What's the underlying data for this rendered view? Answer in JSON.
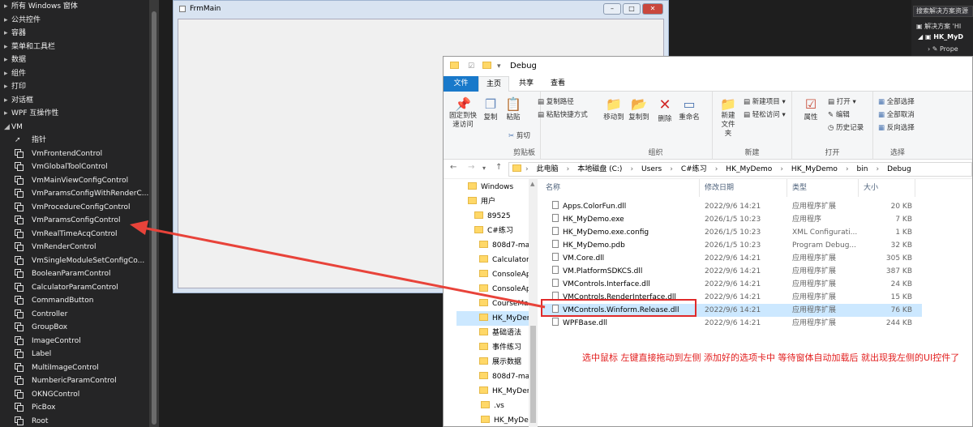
{
  "toolbox": {
    "categories": [
      "所有 Windows 窗体",
      "公共控件",
      "容器",
      "菜单和工具栏",
      "数据",
      "组件",
      "打印",
      "对话框",
      "WPF 互操作性"
    ],
    "vm_category": "VM",
    "pointer": "指针",
    "controls": [
      "VmFrontendControl",
      "VmGlobalToolControl",
      "VmMainViewConfigControl",
      "VmParamsConfigWithRenderC...",
      "VmProcedureConfigControl",
      "VmParamsConfigControl",
      "VmRealTimeAcqControl",
      "VmRenderControl",
      "VmSingleModuleSetConfigCo...",
      "BooleanParamControl",
      "CalculatorParamControl",
      "CommandButton",
      "Controller",
      "GroupBox",
      "ImageControl",
      "Label",
      "MultiImageControl",
      "NumbericParamControl",
      "OKNGControl",
      "PicBox",
      "Root"
    ]
  },
  "form": {
    "title": "FrmMain",
    "min": "0",
    "max": "1",
    "close": "r"
  },
  "solution": {
    "search": "搜索解决方案资源",
    "row1": "解决方案 'HI",
    "row2": "HK_MyD",
    "row3": "Prope"
  },
  "explorer": {
    "title": "Debug",
    "tabs": [
      "文件",
      "主页",
      "共享",
      "查看"
    ],
    "ribbon": {
      "clipboard": {
        "label": "剪贴板",
        "pin": "固定到快速访问",
        "copy": "复制",
        "paste": "粘贴",
        "copy_path": "复制路径",
        "paste_shortcut": "粘贴快捷方式",
        "cut": "剪切"
      },
      "organize": {
        "label": "组织",
        "move_to": "移动到",
        "copy_to": "复制到",
        "delete": "删除",
        "rename": "重命名"
      },
      "new": {
        "label": "新建",
        "new_folder": "新建文件夹",
        "new_item": "新建项目",
        "easy_access": "轻松访问"
      },
      "open": {
        "label": "打开",
        "properties": "属性",
        "open": "打开",
        "edit": "编辑",
        "history": "历史记录"
      },
      "select": {
        "label": "选择",
        "select_all": "全部选择",
        "select_none": "全部取消",
        "invert": "反向选择"
      }
    },
    "address": [
      "此电脑",
      "本地磁盘 (C:)",
      "Users",
      "C#练习",
      "HK_MyDemo",
      "HK_MyDemo",
      "bin",
      "Debug"
    ],
    "nav": [
      {
        "label": "Windows",
        "indent": 1
      },
      {
        "label": "用户",
        "indent": 1
      },
      {
        "label": "89525",
        "indent": 2
      },
      {
        "label": "C#练习",
        "indent": 2
      },
      {
        "label": "808d7-mai",
        "indent": 3
      },
      {
        "label": "Calculator",
        "indent": 3
      },
      {
        "label": "ConsoleAp",
        "indent": 3
      },
      {
        "label": "ConsoleAp",
        "indent": 3
      },
      {
        "label": "CourseMar",
        "indent": 3
      },
      {
        "label": "HK_MyDem",
        "indent": 3,
        "selected": true
      },
      {
        "label": "基础语法",
        "indent": 3
      },
      {
        "label": "事件练习",
        "indent": 3
      },
      {
        "label": "展示数据",
        "indent": 3
      },
      {
        "label": "808d7-mai",
        "indent": 3
      },
      {
        "label": "HK_MyDem",
        "indent": 3
      },
      {
        "label": ".vs",
        "indent": 4
      },
      {
        "label": "HK_MyDe",
        "indent": 4
      }
    ],
    "columns": [
      "名称",
      "修改日期",
      "类型",
      "大小"
    ],
    "files": [
      [
        "Apps.ColorFun.dll",
        "2022/9/6 14:21",
        "应用程序扩展",
        "20 KB"
      ],
      [
        "HK_MyDemo.exe",
        "2026/1/5 10:23",
        "应用程序",
        "7 KB"
      ],
      [
        "HK_MyDemo.exe.config",
        "2026/1/5 10:23",
        "XML Configurati...",
        "1 KB"
      ],
      [
        "HK_MyDemo.pdb",
        "2026/1/5 10:23",
        "Program Debug...",
        "32 KB"
      ],
      [
        "VM.Core.dll",
        "2022/9/6 14:21",
        "应用程序扩展",
        "305 KB"
      ],
      [
        "VM.PlatformSDKCS.dll",
        "2022/9/6 14:21",
        "应用程序扩展",
        "387 KB"
      ],
      [
        "VMControls.Interface.dll",
        "2022/9/6 14:21",
        "应用程序扩展",
        "24 KB"
      ],
      [
        "VMControls.RenderInterface.dll",
        "2022/9/6 14:21",
        "应用程序扩展",
        "15 KB"
      ],
      [
        "VMControls.Winform.Release.dll",
        "2022/9/6 14:21",
        "应用程序扩展",
        "76 KB"
      ],
      [
        "WPFBase.dll",
        "2022/9/6 14:21",
        "应用程序扩展",
        "244 KB"
      ]
    ],
    "highlight_index": 8
  },
  "annotation": {
    "text": "选中鼠标 左键直接拖动到左侧 添加好的选项卡中   等待窗体自动加载后  就出现我左侧的UI控件了",
    "color": "#e21d1d"
  }
}
